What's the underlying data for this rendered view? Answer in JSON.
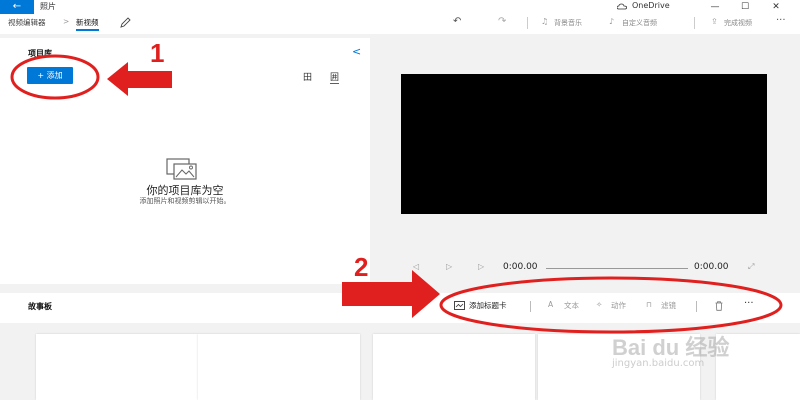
{
  "titlebar": {
    "back_label": "←",
    "app_title": "照片",
    "onedrive_label": "OneDrive",
    "minimize": "—",
    "maximize": "☐",
    "close": "✕"
  },
  "toolbar": {
    "breadcrumb_parent": "视频编辑器",
    "breadcrumb_sep": ">",
    "breadcrumb_current": "新视频",
    "undo_icon": "↶",
    "redo_icon": "↷",
    "music_label": "背景音乐",
    "audio_label": "自定义音频",
    "finish_label": "完成视频",
    "more": "···"
  },
  "library": {
    "title": "项目库",
    "collapse": "<",
    "add_label": "+ 添加",
    "view_grid": "田",
    "view_list": "囲",
    "empty_title": "你的项目库为空",
    "empty_subtitle": "添加照片和视频剪辑以开始。"
  },
  "player": {
    "prev": "◁",
    "play": "▷",
    "next": "▷",
    "time_current": "0:00.00",
    "time_total": "0:00.00",
    "fullscreen": "⤢"
  },
  "storyboard": {
    "title": "故事板",
    "add_title_card": "添加标题卡",
    "text": "文本",
    "motion": "动作",
    "filters": "滤镜",
    "more": "···"
  },
  "annotations": {
    "num1": "1",
    "num2": "2",
    "color": "#e0201e"
  },
  "watermark": {
    "brand": "Bai du 经验",
    "url": "jingyan.baidu.com"
  }
}
